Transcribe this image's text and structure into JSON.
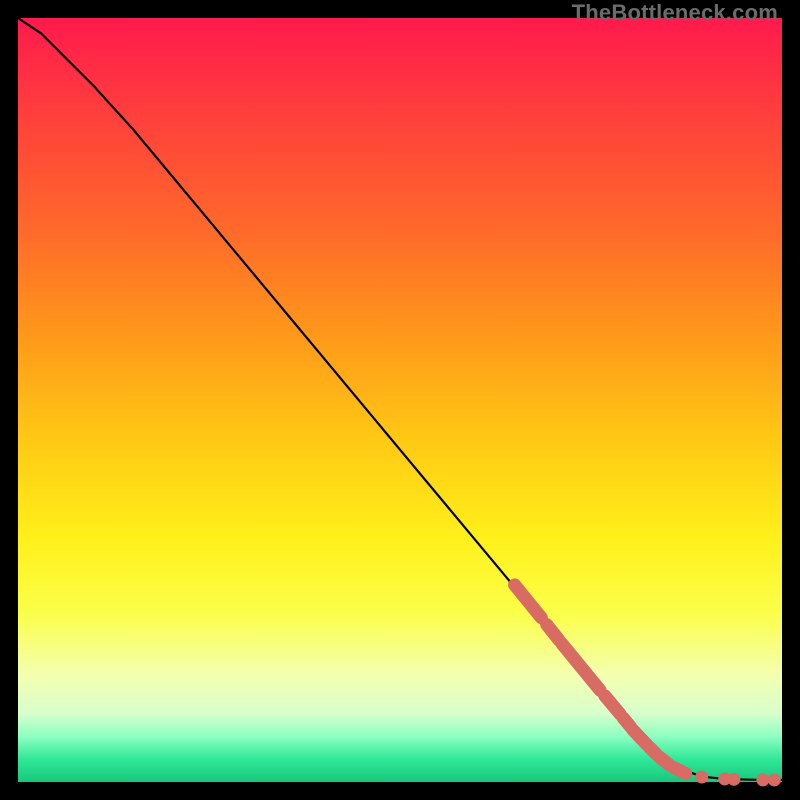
{
  "watermark": "TheBottleneck.com",
  "chart_data": {
    "type": "line",
    "title": "",
    "xlabel": "",
    "ylabel": "",
    "xlim": [
      0,
      100
    ],
    "ylim": [
      0,
      100
    ],
    "colors": {
      "line": "#000000",
      "marker": "#d86b63",
      "gradient_top": "#ff1a4d",
      "gradient_bottom": "#18c77c"
    },
    "series": [
      {
        "name": "main",
        "x": [
          0,
          3,
          6,
          10,
          15,
          20,
          25,
          30,
          35,
          40,
          45,
          50,
          55,
          60,
          65,
          70,
          75,
          80,
          84,
          87,
          89,
          90.5,
          92,
          94,
          96,
          98,
          100
        ],
        "y": [
          100,
          98,
          95,
          91,
          85.5,
          79.5,
          73.5,
          67.5,
          61.5,
          55.5,
          49.5,
          43.5,
          37.5,
          31.5,
          25.5,
          19.5,
          13.5,
          7.8,
          3.5,
          1.6,
          0.9,
          0.6,
          0.45,
          0.35,
          0.3,
          0.28,
          0.27
        ]
      }
    ],
    "overlay_segments": [
      {
        "x0": 65.0,
        "y0": 25.8,
        "x1": 68.5,
        "y1": 21.5
      },
      {
        "x0": 69.2,
        "y0": 20.6,
        "x1": 70.8,
        "y1": 18.6
      },
      {
        "x0": 71.2,
        "y0": 18.1,
        "x1": 76.2,
        "y1": 12.0
      },
      {
        "x0": 76.8,
        "y0": 11.3,
        "x1": 78.8,
        "y1": 8.9
      },
      {
        "x0": 79.2,
        "y0": 8.4,
        "x1": 80.2,
        "y1": 7.2
      },
      {
        "x0": 80.5,
        "y0": 6.8,
        "x1": 82.3,
        "y1": 4.9
      },
      {
        "x0": 82.6,
        "y0": 4.6,
        "x1": 83.5,
        "y1": 3.7
      },
      {
        "x0": 83.9,
        "y0": 3.3,
        "x1": 85.3,
        "y1": 2.2
      },
      {
        "x0": 85.8,
        "y0": 1.9,
        "x1": 87.4,
        "y1": 1.1
      }
    ],
    "overlay_dots": [
      {
        "x": 89.5,
        "y": 0.65
      },
      {
        "x": 92.5,
        "y": 0.4
      },
      {
        "x": 93.7,
        "y": 0.35
      },
      {
        "x": 97.5,
        "y": 0.28
      },
      {
        "x": 99.0,
        "y": 0.27
      }
    ]
  }
}
